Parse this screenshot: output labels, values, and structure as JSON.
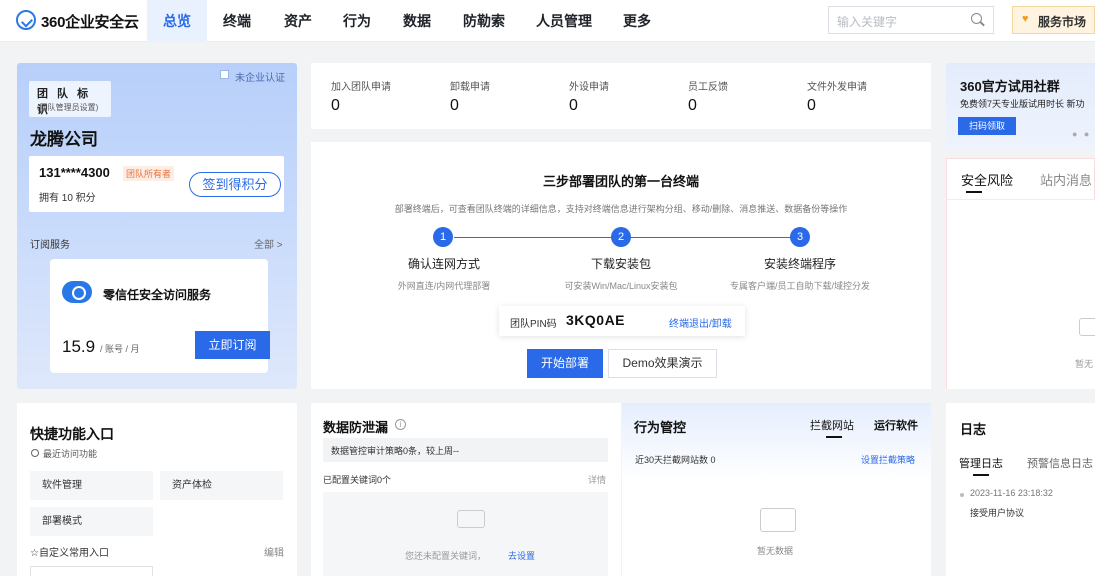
{
  "header": {
    "logo_text": "360企业安全云",
    "nav": [
      "总览",
      "终端",
      "资产",
      "行为",
      "数据",
      "防勒索",
      "人员管理",
      "更多"
    ],
    "active_nav": "总览",
    "search_placeholder": "输入关键字",
    "service_market": "服务市场",
    "accent_color": "#2a6ae8"
  },
  "team": {
    "cert_status": "未企业认证",
    "tag_title": "团 队 标 识",
    "tag_sub": "(团队管理员设置)",
    "company": "龙腾公司",
    "phone": "131****4300",
    "role": "团队所有者",
    "points": "拥有 10 积分",
    "checkin": "签到得积分",
    "subscription_title": "订阅服务",
    "subscription_all": "全部 >",
    "service_name": "零信任安全访问服务",
    "price": "15.9",
    "price_unit": "/ 账号 / 月",
    "subscribe_btn": "立即订阅"
  },
  "stats": [
    {
      "label": "加入团队申请",
      "value": "0"
    },
    {
      "label": "卸载申请",
      "value": "0"
    },
    {
      "label": "外设申请",
      "value": "0"
    },
    {
      "label": "员工反馈",
      "value": "0"
    },
    {
      "label": "文件外发申请",
      "value": "0"
    }
  ],
  "deploy": {
    "title": "三步部署团队的第一台终端",
    "desc": "部署终端后，可查看团队终端的详细信息，支持对终端信息进行架构分组、移动/删除、消息推送、数据备份等操作",
    "steps": [
      {
        "num": "1",
        "title": "确认连网方式",
        "sub": "外网直连/内网代理部署"
      },
      {
        "num": "2",
        "title": "下载安装包",
        "sub": "可安装Win/Mac/Linux安装包"
      },
      {
        "num": "3",
        "title": "安装终端程序",
        "sub": "专属客户端/员工自助下载/域控分发"
      }
    ],
    "pin_label": "团队PIN码",
    "pin_value": "3KQ0AE",
    "pin_action": "终端退出/卸载",
    "start_btn": "开始部署",
    "demo_btn": "Demo效果演示"
  },
  "trial": {
    "title": "360官方试用社群",
    "sub": "免费领7天专业版试用时长 新功",
    "btn": "扫码领取"
  },
  "risk": {
    "tab1": "安全风险",
    "tab2": "站内消息",
    "empty": "暂无"
  },
  "quick": {
    "title": "快捷功能入口",
    "recent": "最近访问功能",
    "items": [
      "软件管理",
      "资产体检",
      "部署模式"
    ],
    "custom": "☆自定义常用入口",
    "edit": "编辑"
  },
  "leak": {
    "title": "数据防泄漏",
    "info": "i",
    "bar_text": "数据管控审计策略0条，较上周--",
    "keywords": "已配置关键词0个",
    "detail": "详情",
    "empty_text": "您还未配置关键词，",
    "empty_link": "去设置"
  },
  "behavior": {
    "title": "行为管控",
    "tab1": "拦截网站",
    "tab2": "运行软件",
    "blocked": "近30天拦截网站数 0",
    "policy": "设置拦截策略",
    "empty": "暂无数据"
  },
  "log": {
    "title": "日志",
    "tab1": "管理日志",
    "tab2": "预警信息日志",
    "time": "2023-11-16 23:18:32",
    "msg": "接受用户协议"
  }
}
